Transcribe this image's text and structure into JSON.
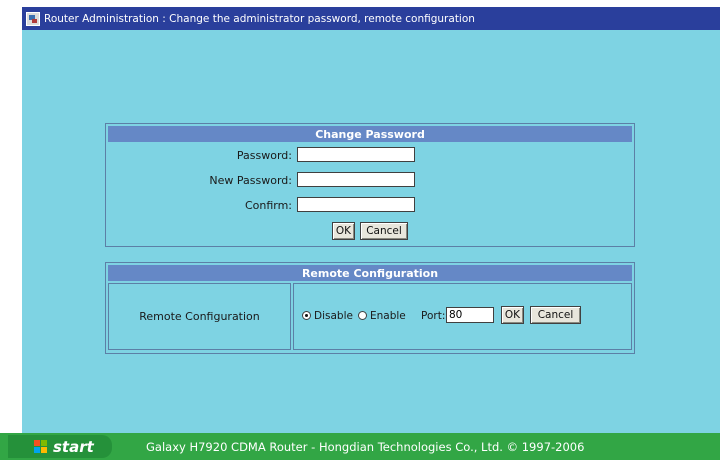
{
  "window": {
    "title": "Router Administration : Change the administrator password, remote configuration"
  },
  "change_password": {
    "header": "Change Password",
    "fields": [
      {
        "label": "Password:",
        "value": ""
      },
      {
        "label": "New Password:",
        "value": ""
      },
      {
        "label": "Confirm:",
        "value": ""
      }
    ],
    "ok_label": "OK",
    "cancel_label": "Cancel"
  },
  "remote_config": {
    "header": "Remote Configuration",
    "row_label": "Remote Configuration",
    "disable_label": "Disable",
    "enable_label": "Enable",
    "selected": "Disable",
    "port_label": "Port:",
    "port_value": "80",
    "ok_label": "OK",
    "cancel_label": "Cancel"
  },
  "taskbar": {
    "start_label": "start",
    "text": "Galaxy H7920 CDMA Router - Hongdian Technologies Co., Ltd. © 1997-2006"
  },
  "icons": {
    "title": "router-app-icon",
    "start": "windows-flag-icon"
  },
  "colors": {
    "title_bar": "#2a3f9c",
    "background": "#7ed3e3",
    "panel_header": "#6588c6",
    "taskbar": "#32a645"
  }
}
